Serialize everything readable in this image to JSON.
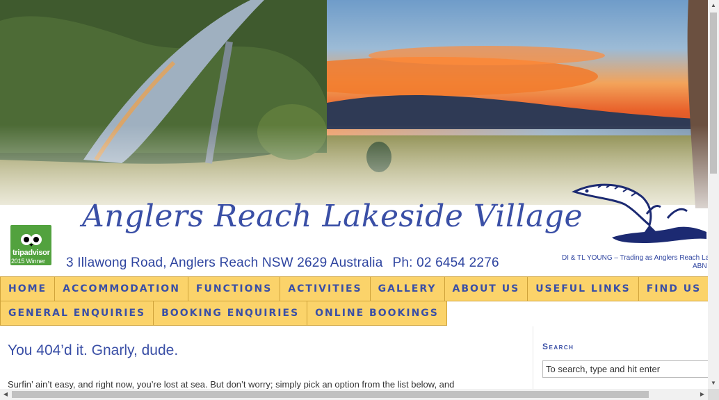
{
  "header": {
    "site_title": "Anglers Reach Lakeside Village",
    "address": "3 Illawong Road, Anglers Reach NSW 2629 Australia",
    "phone": "Ph: 02 6454 2276",
    "owner": "DI & TL YOUNG – Trading as Anglers Reach La",
    "abn": "ABN",
    "tripadvisor": {
      "brand": "tripadvisor",
      "award": "2015 Winner"
    }
  },
  "nav": {
    "row1": [
      "HOME",
      "ACCOMMODATION",
      "FUNCTIONS",
      "ACTIVITIES",
      "GALLERY",
      "ABOUT US",
      "USEFUL LINKS",
      "FIND US"
    ],
    "row2": [
      "GENERAL ENQUIRIES",
      "BOOKING ENQUIRIES",
      "ONLINE BOOKINGS"
    ]
  },
  "main": {
    "title": "You 404’d it. Gnarly, dude.",
    "text": "Surfin’ ain’t easy, and right now, you’re lost at sea. But don’t worry; simply pick an option from the list below, and"
  },
  "sidebar": {
    "search_title": "Search",
    "search_placeholder": "To search, type and hit enter"
  },
  "icons": {
    "tripadvisor": "owl-icon",
    "fish": "jumping-fish-logo",
    "scroll_up": "chevron-up-icon",
    "scroll_down": "chevron-down-icon",
    "scroll_left": "chevron-left-icon",
    "scroll_right": "chevron-right-icon"
  },
  "colors": {
    "nav_bg": "#fbd36a",
    "nav_text": "#3a4fa6",
    "title_blue": "#3a4fa6",
    "tripadvisor_green": "#52a23e"
  }
}
